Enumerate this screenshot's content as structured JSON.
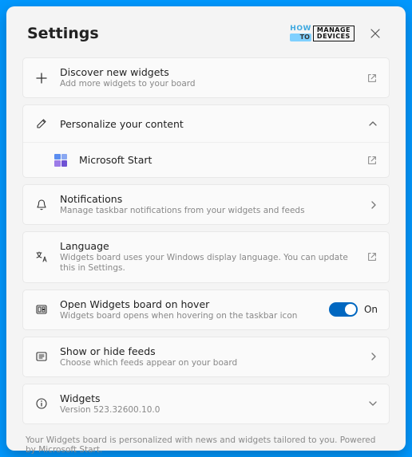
{
  "header": {
    "title": "Settings"
  },
  "logo": {
    "how": "HOW",
    "to": "TO",
    "manage": "MANAGE",
    "devices": "DEVICES"
  },
  "items": {
    "discover": {
      "title": "Discover new widgets",
      "subtitle": "Add more widgets to your board"
    },
    "personalize": {
      "title": "Personalize your content"
    },
    "msstart": {
      "title": "Microsoft Start"
    },
    "notifications": {
      "title": "Notifications",
      "subtitle": "Manage taskbar notifications from your widgets and feeds"
    },
    "language": {
      "title": "Language",
      "subtitle": "Widgets board uses your Windows display language. You can update this in Settings."
    },
    "hover": {
      "title": "Open Widgets board on hover",
      "subtitle": "Widgets board opens when hovering on the taskbar icon",
      "toggle_state": "On"
    },
    "feeds": {
      "title": "Show or hide feeds",
      "subtitle": "Choose which feeds appear on your board"
    },
    "widgets": {
      "title": "Widgets",
      "subtitle": "Version 523.32600.10.0"
    }
  },
  "footer": "Your Widgets board is personalized with news and widgets tailored to you. Powered by Microsoft Start."
}
